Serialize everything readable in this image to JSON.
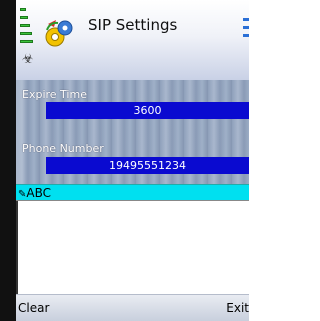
{
  "title_bar": {
    "title": "SIP Settings",
    "signal_icon": "signal-strength-icon",
    "app_icon": "sip-settings-icon",
    "battery_icon": "battery-icon",
    "antenna_icon": "antenna-icon"
  },
  "fields": [
    {
      "label": "Expire Time",
      "value": "3600"
    },
    {
      "label": "Phone Number",
      "value": "19495551234"
    }
  ],
  "input_mode": {
    "label": "ABC",
    "icon": "pen-input-icon"
  },
  "text_entry": {
    "value": ""
  },
  "softkeys": {
    "left": "Clear",
    "right": "Exit"
  },
  "colors": {
    "field_bg": "#0a0ad0",
    "input_header_bg": "#00e0f0",
    "signal": "#3cc43c"
  }
}
